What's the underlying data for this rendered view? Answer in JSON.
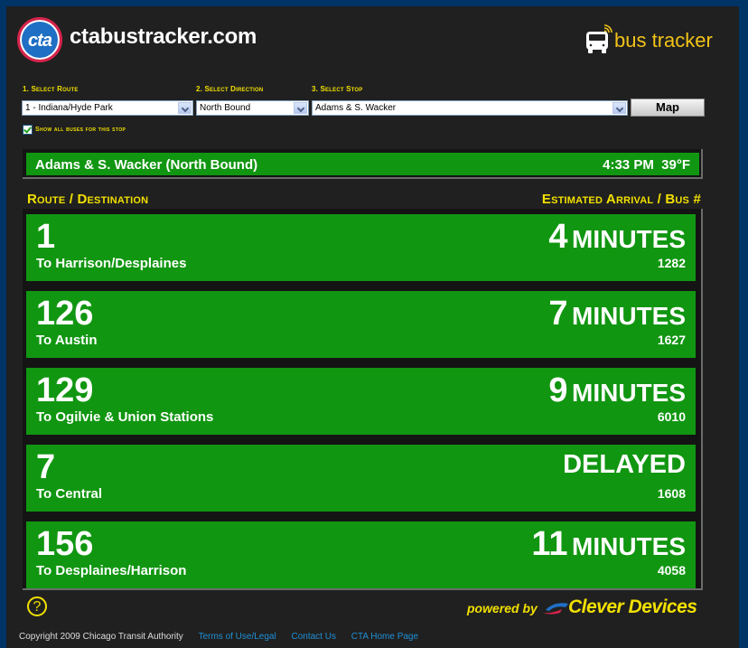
{
  "header": {
    "logo_text": "cta",
    "site_title": "ctabustracker.com",
    "bus_tracker_label": "bus tracker"
  },
  "selectors": {
    "route": {
      "label_num": "1.",
      "label": "Select Route",
      "value": "1 - Indiana/Hyde Park"
    },
    "direction": {
      "label_num": "2.",
      "label": "Select Direction",
      "value": "North Bound"
    },
    "stop": {
      "label_num": "3.",
      "label": "Select Stop",
      "value": "Adams & S. Wacker"
    },
    "map_button": "Map",
    "show_all": {
      "checked": true,
      "label": "Show all buses for this stop"
    }
  },
  "stop_bar": {
    "name": "Adams & S. Wacker (North Bound)",
    "time_weather": "4:33 PM  39°F"
  },
  "columns": {
    "left": "Route / Destination",
    "right": "Estimated Arrival / Bus #"
  },
  "arrivals": [
    {
      "route": "1",
      "destination": "To Harrison/Desplaines",
      "eta_num": "4",
      "eta_unit": "MINUTES",
      "bus": "1282"
    },
    {
      "route": "126",
      "destination": "To Austin",
      "eta_num": "7",
      "eta_unit": "MINUTES",
      "bus": "1627"
    },
    {
      "route": "129",
      "destination": "To Ogilvie & Union Stations",
      "eta_num": "9",
      "eta_unit": "MINUTES",
      "bus": "6010"
    },
    {
      "route": "7",
      "destination": "To Central",
      "eta_status": "DELAYED",
      "bus": "1608"
    },
    {
      "route": "156",
      "destination": "To Desplaines/Harrison",
      "eta_num": "11",
      "eta_unit": "MINUTES",
      "bus": "4058"
    }
  ],
  "footer": {
    "help": "?",
    "powered_by": "powered by",
    "brand": "Clever Devices",
    "copyright": "Copyright 2009 Chicago Transit Authority",
    "links": [
      "Terms of Use/Legal",
      "Contact Us",
      "CTA Home Page"
    ]
  },
  "colors": {
    "background_blue": "#003366",
    "panel": "#202020",
    "accent_yellow": "#f2e000",
    "row_green": "#119611",
    "link_blue": "#1e90d6"
  }
}
